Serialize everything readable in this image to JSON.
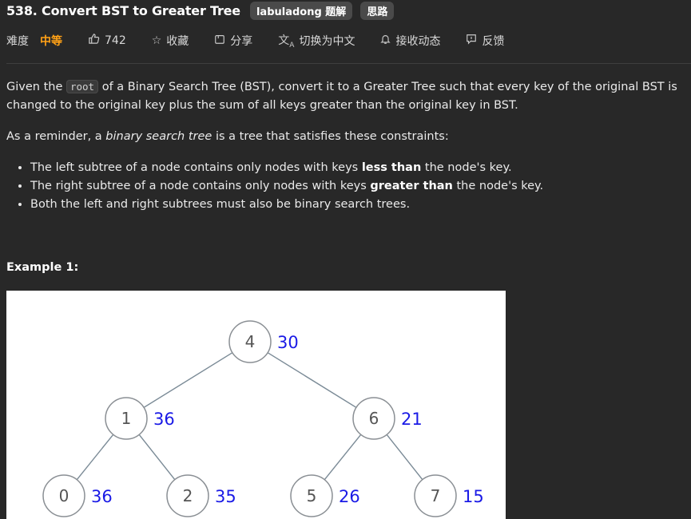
{
  "problem": {
    "title": "538. Convert BST to Greater Tree",
    "tags": [
      "labuladong 题解",
      "思路"
    ]
  },
  "meta": {
    "difficulty_label": "难度",
    "difficulty_value": "中等",
    "likes": "742",
    "favorite": "收藏",
    "share": "分享",
    "switch_lang": "切换为中文",
    "subscribe": "接收动态",
    "feedback": "反馈"
  },
  "description": {
    "p1_pre": "Given the ",
    "p1_code": "root",
    "p1_post": " of a Binary Search Tree (BST), convert it to a Greater Tree such that every key of the original BST is changed to the original key plus the sum of all keys greater than the original key in BST.",
    "p2_pre": "As a reminder, a ",
    "p2_em": "binary search tree",
    "p2_post": " is a tree that satisfies these constraints:",
    "bullets": [
      {
        "pre": "The left subtree of a node contains only nodes with keys ",
        "bold": "less than",
        "post": " the node's key."
      },
      {
        "pre": "The right subtree of a node contains only nodes with keys ",
        "bold": "greater than",
        "post": " the node's key."
      },
      {
        "pre": "Both the left and right subtrees must also be binary search trees.",
        "bold": "",
        "post": ""
      }
    ]
  },
  "example": {
    "title": "Example 1:",
    "nodes": [
      {
        "key": "4",
        "sum": "30"
      },
      {
        "key": "1",
        "sum": "36"
      },
      {
        "key": "6",
        "sum": "21"
      },
      {
        "key": "0",
        "sum": "36"
      },
      {
        "key": "2",
        "sum": "35"
      },
      {
        "key": "5",
        "sum": "26"
      },
      {
        "key": "7",
        "sum": "15"
      }
    ]
  },
  "colors": {
    "accent_difficulty": "#ffa116",
    "sum_label": "#1a1ae6",
    "edge": "#7a8a96"
  }
}
